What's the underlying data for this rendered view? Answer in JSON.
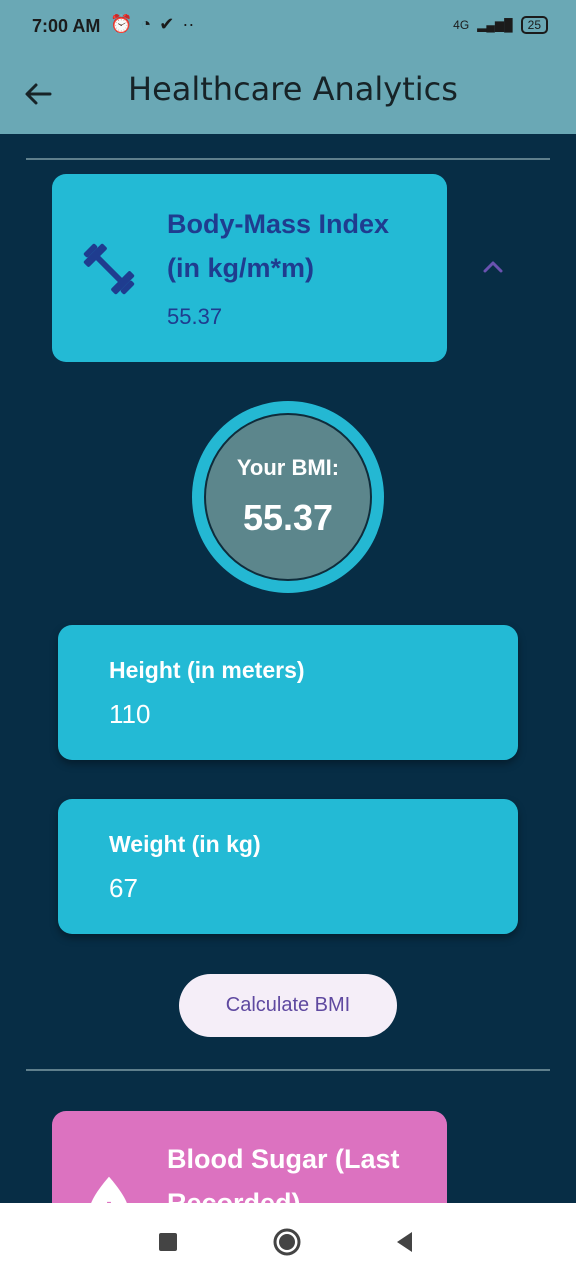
{
  "status_bar": {
    "time": "7:00 AM",
    "network": "4G",
    "battery": "25"
  },
  "app_bar": {
    "title": "Healthcare Analytics"
  },
  "bmi_card": {
    "title": "Body-Mass Index\n(in kg/m*m)",
    "value": "55.37"
  },
  "bmi_display": {
    "label": "Your BMI:",
    "value": "55.37"
  },
  "height_field": {
    "label": "Height (in meters)",
    "value": "110"
  },
  "weight_field": {
    "label": "Weight (in kg)",
    "value": "67"
  },
  "calculate_button": {
    "label": "Calculate BMI"
  },
  "sugar_card": {
    "title": "Blood Sugar (Last\nRecorded)"
  },
  "colors": {
    "background": "#072d45",
    "app_bar": "#6aa8b5",
    "card_blue": "#23bad5",
    "card_pink": "#dc72c0",
    "title_blue": "#1f3c8f",
    "button_text": "#5f49a0"
  },
  "icons": {
    "back": "arrow-left-icon",
    "fitness": "dumbbell-icon",
    "expand": "chevron-up-icon",
    "sugar": "blood-drop-icon",
    "nav_recents": "square-icon",
    "nav_home": "circle-icon",
    "nav_back": "triangle-icon"
  }
}
